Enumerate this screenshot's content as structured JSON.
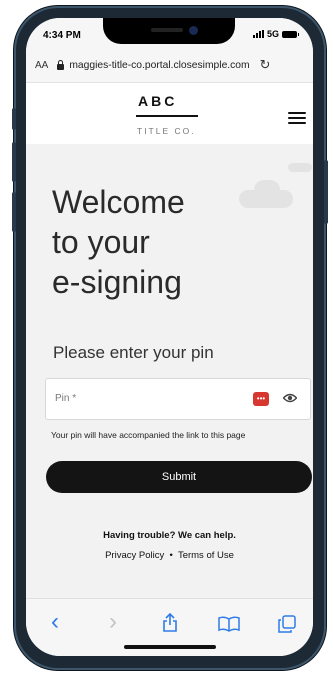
{
  "status": {
    "time": "4:34 PM",
    "network": "5G"
  },
  "browser": {
    "aa": "AA",
    "url": "maggies-title-co.portal.closesimple.com",
    "reload_glyph": "↻"
  },
  "header": {
    "logo_top": "ABC",
    "logo_bottom": "TITLE CO."
  },
  "main": {
    "welcome_lines": [
      "Welcome",
      "to your",
      "e-signing"
    ],
    "prompt": "Please enter your pin",
    "pin_placeholder": "Pin *",
    "hint": "Your pin will have accompanied the link to this page",
    "submit_label": "Submit",
    "trouble": "Having trouble? We can help.",
    "privacy": "Privacy Policy",
    "separator": "•",
    "terms": "Terms of Use"
  },
  "toolbar": {
    "back_glyph": "‹",
    "forward_glyph": "›"
  },
  "icons": [
    "lock-icon",
    "reload-icon",
    "menu-icon",
    "password-manager-icon",
    "eye-icon",
    "back-icon",
    "forward-icon",
    "share-icon",
    "bookmarks-icon",
    "tabs-icon"
  ],
  "colors": {
    "accent": "#2f7ce8",
    "button": "#141414",
    "pw_icon": "#d8372f"
  }
}
